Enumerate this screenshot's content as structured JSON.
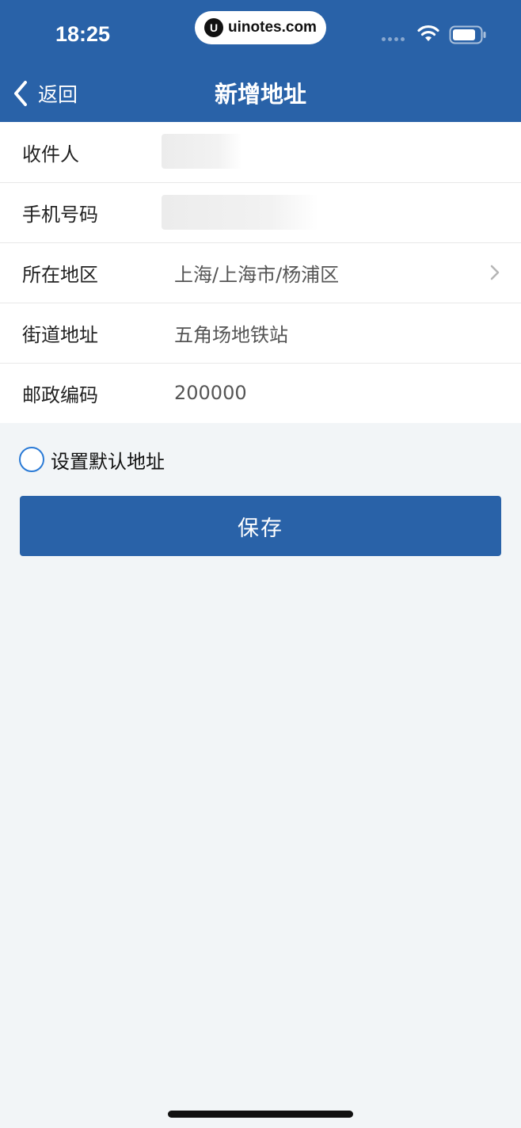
{
  "status_bar": {
    "time": "18:25",
    "url": "uinotes.com",
    "url_logo": "U",
    "icons": [
      "signal-dots-icon",
      "wifi-icon",
      "battery-icon"
    ]
  },
  "nav": {
    "back_label": "返回",
    "title": "新增地址"
  },
  "form": {
    "recipient": {
      "label": "收件人",
      "value": ""
    },
    "phone": {
      "label": "手机号码",
      "value": ""
    },
    "region": {
      "label": "所在地区",
      "value": "上海/上海市/杨浦区"
    },
    "street": {
      "label": "街道地址",
      "value": "五角场地铁站"
    },
    "postcode": {
      "label": "邮政编码",
      "value": "200000"
    }
  },
  "default_address": {
    "label": "设置默认地址",
    "checked": false
  },
  "save_label": "保存",
  "colors": {
    "primary": "#2962a8",
    "background": "#f2f5f7",
    "radio_border": "#2a7ad6"
  }
}
